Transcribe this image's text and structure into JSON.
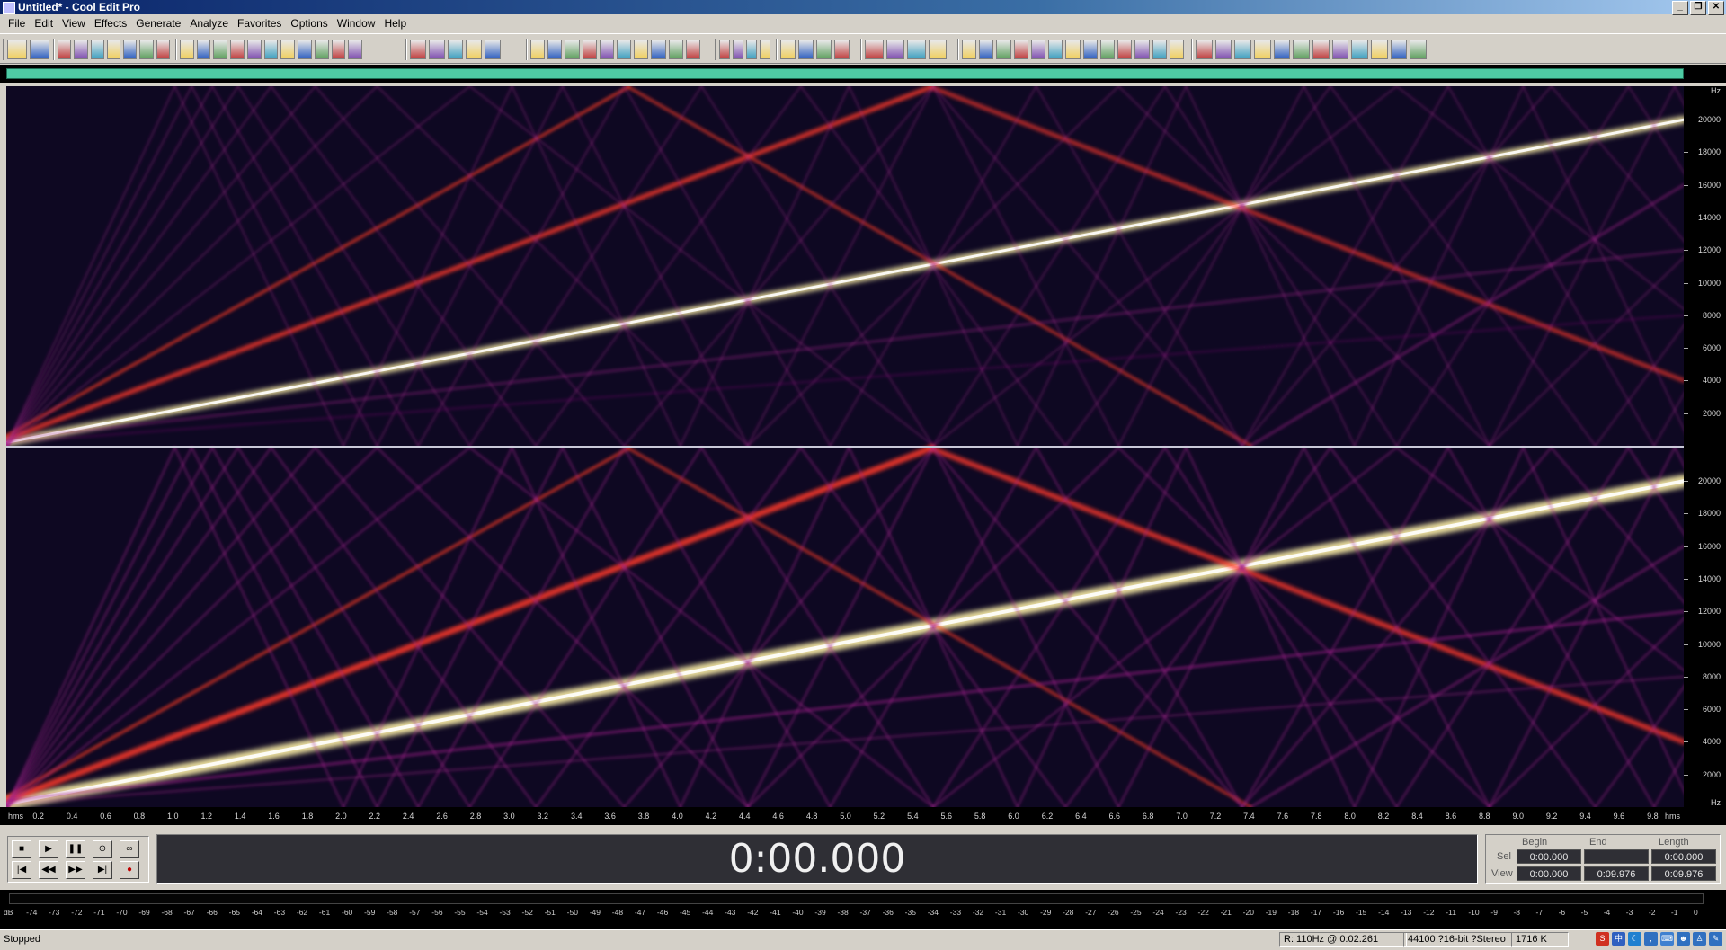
{
  "window": {
    "title": "Untitled* - Cool Edit Pro"
  },
  "window_controls": {
    "minimize": "_",
    "restore": "❐",
    "close": "✕"
  },
  "menu": [
    "File",
    "Edit",
    "View",
    "Effects",
    "Generate",
    "Analyze",
    "Favorites",
    "Options",
    "Window",
    "Help"
  ],
  "spectral": {
    "freq_unit": "Hz",
    "freq_labels": [
      "20000",
      "18000",
      "16000",
      "14000",
      "12000",
      "10000",
      "8000",
      "6000",
      "4000",
      "2000"
    ],
    "freq_max": 22050,
    "time_start_label": "hms",
    "time_end_label": "hms",
    "time_labels": [
      "0.2",
      "0.4",
      "0.6",
      "0.8",
      "1.0",
      "1.2",
      "1.4",
      "1.6",
      "1.8",
      "2.0",
      "2.2",
      "2.4",
      "2.6",
      "2.8",
      "3.0",
      "3.2",
      "3.4",
      "3.6",
      "3.8",
      "4.0",
      "4.2",
      "4.4",
      "4.6",
      "4.8",
      "5.0",
      "5.2",
      "5.4",
      "5.6",
      "5.8",
      "6.0",
      "6.2",
      "6.4",
      "6.6",
      "6.8",
      "7.0",
      "7.2",
      "7.4",
      "7.6",
      "7.8",
      "8.0",
      "8.2",
      "8.4",
      "8.6",
      "8.8",
      "9.0",
      "9.2",
      "9.4",
      "9.6",
      "9.8"
    ],
    "duration_s": 9.976
  },
  "transport": {
    "time": "0:00.000",
    "buttons_row1": [
      "stop",
      "play",
      "pause",
      "play-to-end",
      "loop"
    ],
    "buttons_row2": [
      "go-to-start",
      "rewind",
      "fast-forward",
      "go-to-end",
      "record"
    ]
  },
  "selection": {
    "headers": {
      "begin": "Begin",
      "end": "End",
      "length": "Length"
    },
    "sel": {
      "label": "Sel",
      "begin": "0:00.000",
      "end": "",
      "length": "0:00.000"
    },
    "view": {
      "label": "View",
      "begin": "0:00.000",
      "end": "0:09.976",
      "length": "0:09.976"
    }
  },
  "meter": {
    "labels": [
      "dB",
      "-74",
      "-73",
      "-72",
      "-71",
      "-70",
      "-69",
      "-68",
      "-67",
      "-66",
      "-65",
      "-64",
      "-63",
      "-62",
      "-61",
      "-60",
      "-59",
      "-58",
      "-57",
      "-56",
      "-55",
      "-54",
      "-53",
      "-52",
      "-51",
      "-50",
      "-49",
      "-48",
      "-47",
      "-46",
      "-45",
      "-44",
      "-43",
      "-42",
      "-41",
      "-40",
      "-39",
      "-38",
      "-37",
      "-36",
      "-35",
      "-34",
      "-33",
      "-32",
      "-31",
      "-30",
      "-29",
      "-28",
      "-27",
      "-26",
      "-25",
      "-24",
      "-23",
      "-22",
      "-21",
      "-20",
      "-19",
      "-18",
      "-17",
      "-16",
      "-15",
      "-14",
      "-13",
      "-12",
      "-11",
      "-10",
      "-9",
      "-8",
      "-7",
      "-6",
      "-5",
      "-4",
      "-3",
      "-2",
      "-1",
      "0"
    ]
  },
  "status": {
    "state": "Stopped",
    "cursor": "R: 110Hz @  0:02.261",
    "format": "44100 ?16-bit ?Stereo",
    "size": "1716 K"
  },
  "colors": {
    "spectrogram_bg": "#0e0822",
    "overview": "#4ecba4",
    "hot": "#fff2a8",
    "mid": "#ff3a2a",
    "faint": "#a0208a"
  }
}
